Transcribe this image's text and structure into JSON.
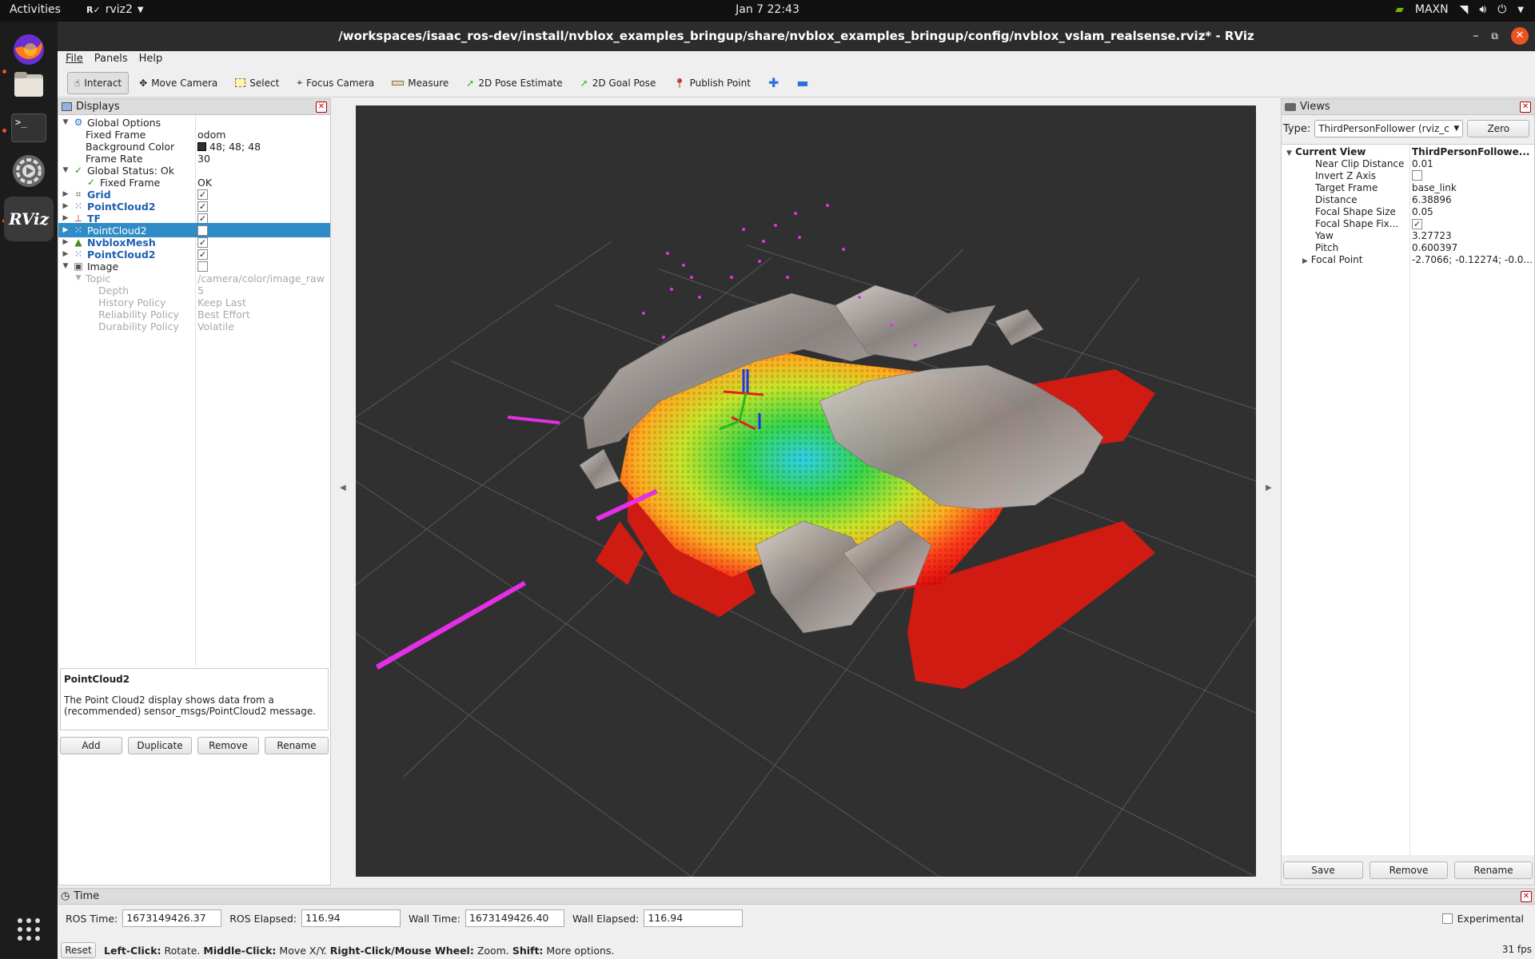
{
  "topbar": {
    "activities": "Activities",
    "app": "rviz2",
    "clock": "Jan 7  22:43",
    "nvidia": "MAXN"
  },
  "dock": {
    "apps": [
      "firefox-icon",
      "files-icon",
      "terminal-icon",
      "settings-icon",
      "rviz-icon",
      "app-grid-icon"
    ],
    "rviz_label": "RViz"
  },
  "window": {
    "title": "/workspaces/isaac_ros-dev/install/nvblox_examples_bringup/share/nvblox_examples_bringup/config/nvblox_vslam_realsense.rviz* - RViz"
  },
  "menu": [
    "File",
    "Panels",
    "Help"
  ],
  "toolbar": {
    "interact": "Interact",
    "move_camera": "Move Camera",
    "select": "Select",
    "focus_camera": "Focus Camera",
    "measure": "Measure",
    "pose_estimate": "2D Pose Estimate",
    "goal_pose": "2D Goal Pose",
    "publish_point": "Publish Point"
  },
  "displays": {
    "title": "Displays",
    "global_options": "Global Options",
    "fixed_frame_label": "Fixed Frame",
    "fixed_frame_value": "odom",
    "bg_color_label": "Background Color",
    "bg_color_value": "48; 48; 48",
    "bg_color_hex": "#303030",
    "frame_rate_label": "Frame Rate",
    "frame_rate_value": "30",
    "global_status": "Global Status: Ok",
    "status_fixed_frame": "Fixed Frame",
    "status_fixed_frame_value": "OK",
    "grid": "Grid",
    "pointcloud_a": "PointCloud2",
    "tf": "TF",
    "pointcloud_sel": "PointCloud2",
    "nvblox_mesh": "NvbloxMesh",
    "pointcloud_b": "PointCloud2",
    "image": "Image",
    "topic_label": "Topic",
    "topic_value": "/camera/color/image_raw",
    "depth_label": "Depth",
    "depth_value": "5",
    "history_label": "History Policy",
    "history_value": "Keep Last",
    "reliability_label": "Reliability Policy",
    "reliability_value": "Best Effort",
    "durability_label": "Durability Policy",
    "durability_value": "Volatile",
    "desc_title": "PointCloud2",
    "desc_text": "The Point Cloud2 display shows data from a (recommended) sensor_msgs/PointCloud2 message.",
    "btn_add": "Add",
    "btn_duplicate": "Duplicate",
    "btn_remove": "Remove",
    "btn_rename": "Rename"
  },
  "views": {
    "title": "Views",
    "type_label": "Type:",
    "type_value": "ThirdPersonFollower (rviz_c",
    "zero": "Zero",
    "current_view": "Current View",
    "current_view_value": "ThirdPersonFollowe...",
    "near_clip_label": "Near Clip Distance",
    "near_clip_value": "0.01",
    "invert_z_label": "Invert Z Axis",
    "target_frame_label": "Target Frame",
    "target_frame_value": "base_link",
    "distance_label": "Distance",
    "distance_value": "6.38896",
    "focal_size_label": "Focal Shape Size",
    "focal_size_value": "0.05",
    "focal_fixed_label": "Focal Shape Fix...",
    "yaw_label": "Yaw",
    "yaw_value": "3.27723",
    "pitch_label": "Pitch",
    "pitch_value": "0.600397",
    "focal_point_label": "Focal Point",
    "focal_point_value": "-2.7066; -0.12274; -0.0...",
    "btn_save": "Save",
    "btn_remove": "Remove",
    "btn_rename": "Rename"
  },
  "time": {
    "title": "Time",
    "ros_time_label": "ROS Time:",
    "ros_time_value": "1673149426.37",
    "ros_elapsed_label": "ROS Elapsed:",
    "ros_elapsed_value": "116.94",
    "wall_time_label": "Wall Time:",
    "wall_time_value": "1673149426.40",
    "wall_elapsed_label": "Wall Elapsed:",
    "wall_elapsed_value": "116.94",
    "experimental": "Experimental"
  },
  "status": {
    "reset": "Reset",
    "left_click": "Left-Click:",
    "left_click_action": "Rotate.",
    "middle_click": "Middle-Click:",
    "middle_click_action": "Move X/Y.",
    "right_click": "Right-Click/Mouse Wheel:",
    "right_click_action": "Zoom.",
    "shift": "Shift:",
    "shift_action": "More options.",
    "fps": "31 fps"
  }
}
